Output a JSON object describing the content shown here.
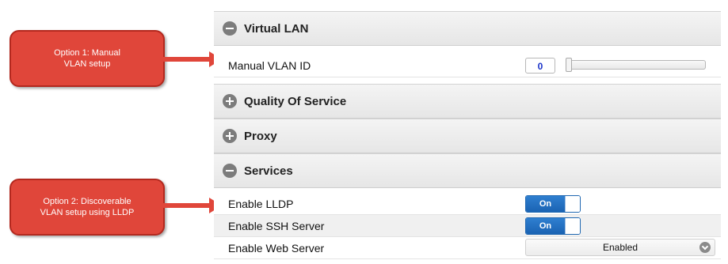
{
  "annotations": {
    "option1": {
      "line1": "Option 1: Manual",
      "line2": "VLAN setup"
    },
    "option2": {
      "line1": "Option 2: Discoverable",
      "line2": "VLAN setup using LLDP"
    },
    "color": "#e0463a"
  },
  "sections": {
    "virtual_lan": {
      "title": "Virtual LAN",
      "state": "expanded"
    },
    "qos": {
      "title": "Quality Of Service",
      "state": "collapsed"
    },
    "proxy": {
      "title": "Proxy",
      "state": "collapsed"
    },
    "services": {
      "title": "Services",
      "state": "expanded"
    }
  },
  "vlan": {
    "manual_id_label": "Manual VLAN ID",
    "manual_id_value": "0",
    "slider_level": 0
  },
  "services": {
    "lldp": {
      "label": "Enable LLDP",
      "state": "On"
    },
    "ssh": {
      "label": "Enable SSH Server",
      "state": "On"
    },
    "web": {
      "label": "Enable Web Server",
      "value": "Enabled"
    }
  },
  "colors": {
    "switch_on": "#1a63b3",
    "value_text": "#1a33c9"
  }
}
